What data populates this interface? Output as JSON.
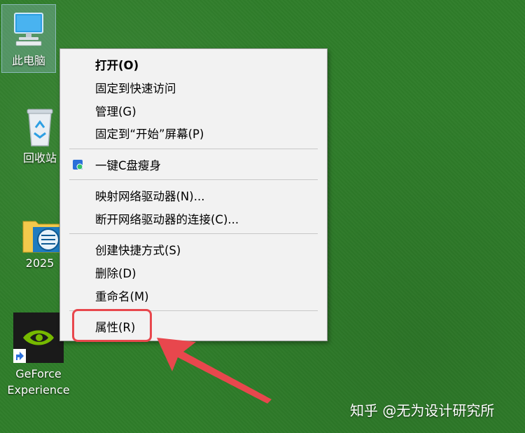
{
  "desktop_icons": [
    {
      "label": "此电脑",
      "icon": "computer-icon"
    },
    {
      "label": "回收站",
      "icon": "recycle-bin-icon"
    },
    {
      "label": "2025",
      "icon": "folder-icon"
    },
    {
      "label": "GeForce\nExperience",
      "icon": "nvidia-geforce-icon",
      "shortcut": true
    }
  ],
  "context_menu": {
    "items": [
      {
        "label": "打开(O)",
        "bold": true
      },
      {
        "label": "固定到快速访问"
      },
      {
        "label": "管理(G)"
      },
      {
        "label": "固定到“开始”屏幕(P)"
      },
      {
        "label": "一键C盘瘦身",
        "icon": "cleanup-icon"
      },
      {
        "label": "映射网络驱动器(N)..."
      },
      {
        "label": "断开网络驱动器的连接(C)..."
      },
      {
        "label": "创建快捷方式(S)"
      },
      {
        "label": "删除(D)"
      },
      {
        "label": "重命名(M)"
      },
      {
        "label": "属性(R)",
        "highlighted": true
      }
    ]
  },
  "annotation": {
    "color": "#e8474d"
  },
  "watermark": {
    "text": "知乎 @无为设计研究所"
  }
}
